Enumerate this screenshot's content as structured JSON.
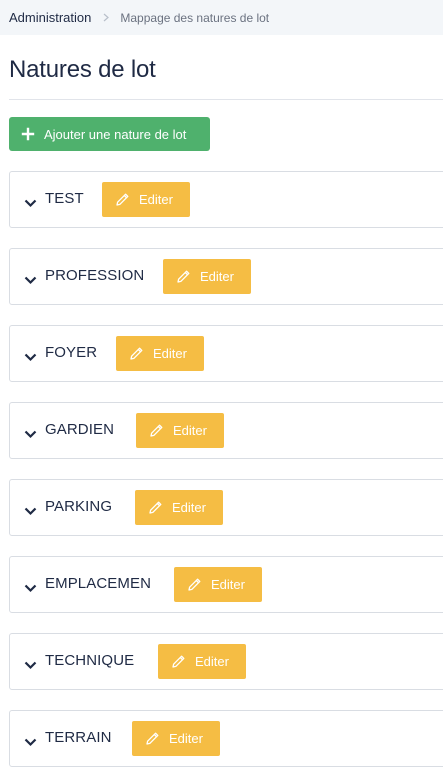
{
  "breadcrumb": {
    "root": "Administration",
    "current": "Mappage des natures de lot"
  },
  "page": {
    "title": "Natures de lot",
    "add_button_label": "Ajouter une nature de lot"
  },
  "lot_natures": [
    {
      "name": "TEST",
      "edit_label": "Editer"
    },
    {
      "name": "PROFESSION",
      "edit_label": "Editer"
    },
    {
      "name": "FOYER",
      "edit_label": "Editer"
    },
    {
      "name": "GARDIEN",
      "edit_label": "Editer"
    },
    {
      "name": "PARKING",
      "edit_label": "Editer"
    },
    {
      "name": "EMPLACEMEN",
      "edit_label": "Editer"
    },
    {
      "name": "TECHNIQUE",
      "edit_label": "Editer"
    },
    {
      "name": "TERRAIN",
      "edit_label": "Editer"
    }
  ],
  "colors": {
    "primary_green": "#4fb16d",
    "edit_yellow": "#f5bd44",
    "text_dark": "#1f2a44"
  },
  "icons": {
    "breadcrumb_separator": "chevron-right-icon",
    "add": "plus-icon",
    "expand": "chevron-down-icon",
    "edit": "pencil-icon"
  }
}
